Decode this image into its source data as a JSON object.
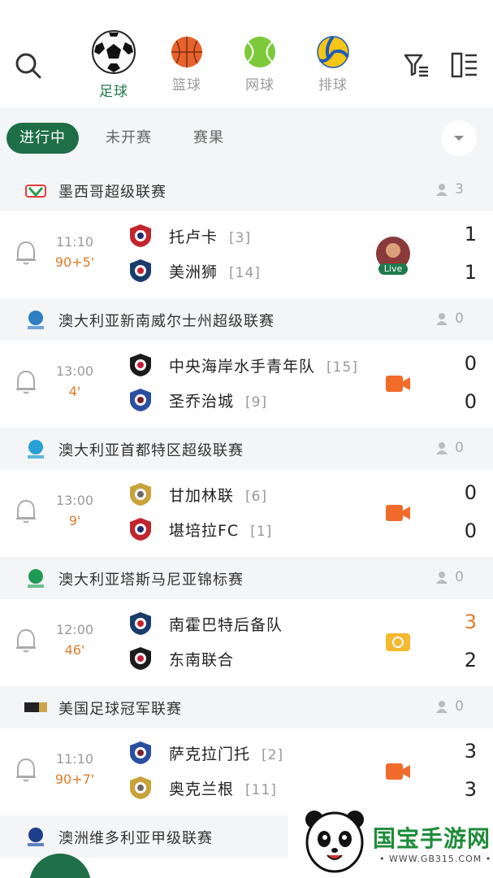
{
  "sports": [
    {
      "label": "足球",
      "icon": "soccer-ball-icon",
      "active": true
    },
    {
      "label": "篮球",
      "icon": "basketball-icon",
      "active": false
    },
    {
      "label": "网球",
      "icon": "tennis-ball-icon",
      "active": false
    },
    {
      "label": "排球",
      "icon": "volleyball-icon",
      "active": false
    }
  ],
  "tabs": [
    {
      "label": "进行中",
      "active": true
    },
    {
      "label": "未开赛",
      "active": false
    },
    {
      "label": "赛果",
      "active": false
    }
  ],
  "colors": {
    "accent": "#1e6e47",
    "live_minute": "#e07b2a",
    "video": "#f26b2a",
    "tv": "#f5b82e"
  },
  "leagues": [
    {
      "name": "墨西哥超级联赛",
      "count": "3",
      "matches": [
        {
          "time": "11:10",
          "minute": "90+5'",
          "home": {
            "name": "托卢卡",
            "rank": "[3]"
          },
          "away": {
            "name": "美洲狮",
            "rank": "[14]"
          },
          "home_score": "1",
          "away_score": "1",
          "media": "live",
          "live_label": "Live"
        }
      ]
    },
    {
      "name": "澳大利亚新南威尔士州超级联赛",
      "count": "0",
      "matches": [
        {
          "time": "13:00",
          "minute": "4'",
          "home": {
            "name": "中央海岸水手青年队",
            "rank": "[15]"
          },
          "away": {
            "name": "圣乔治城",
            "rank": "[9]"
          },
          "home_score": "0",
          "away_score": "0",
          "media": "video"
        }
      ]
    },
    {
      "name": "澳大利亚首都特区超级联赛",
      "count": "0",
      "matches": [
        {
          "time": "13:00",
          "minute": "9'",
          "home": {
            "name": "甘加林联",
            "rank": "[6]"
          },
          "away": {
            "name": "堪培拉FC",
            "rank": "[1]"
          },
          "home_score": "0",
          "away_score": "0",
          "media": "video"
        }
      ]
    },
    {
      "name": "澳大利亚塔斯马尼亚锦标赛",
      "count": "0",
      "matches": [
        {
          "time": "12:00",
          "minute": "46'",
          "home": {
            "name": "南霍巴特后备队",
            "rank": ""
          },
          "away": {
            "name": "东南联合",
            "rank": ""
          },
          "home_score": "3",
          "away_score": "2",
          "media": "tv",
          "home_highlight": true
        }
      ]
    },
    {
      "name": "美国足球冠军联赛",
      "count": "0",
      "matches": [
        {
          "time": "11:10",
          "minute": "90+7'",
          "home": {
            "name": "萨克拉门托",
            "rank": "[2]"
          },
          "away": {
            "name": "奥克兰根",
            "rank": "[11]"
          },
          "home_score": "3",
          "away_score": "3",
          "media": "video"
        }
      ]
    },
    {
      "name": "澳洲维多利亚甲级联赛",
      "count": "",
      "matches": []
    }
  ],
  "watermark": {
    "title": "国宝手游网",
    "url": "• WWW.GB315.COM •"
  }
}
